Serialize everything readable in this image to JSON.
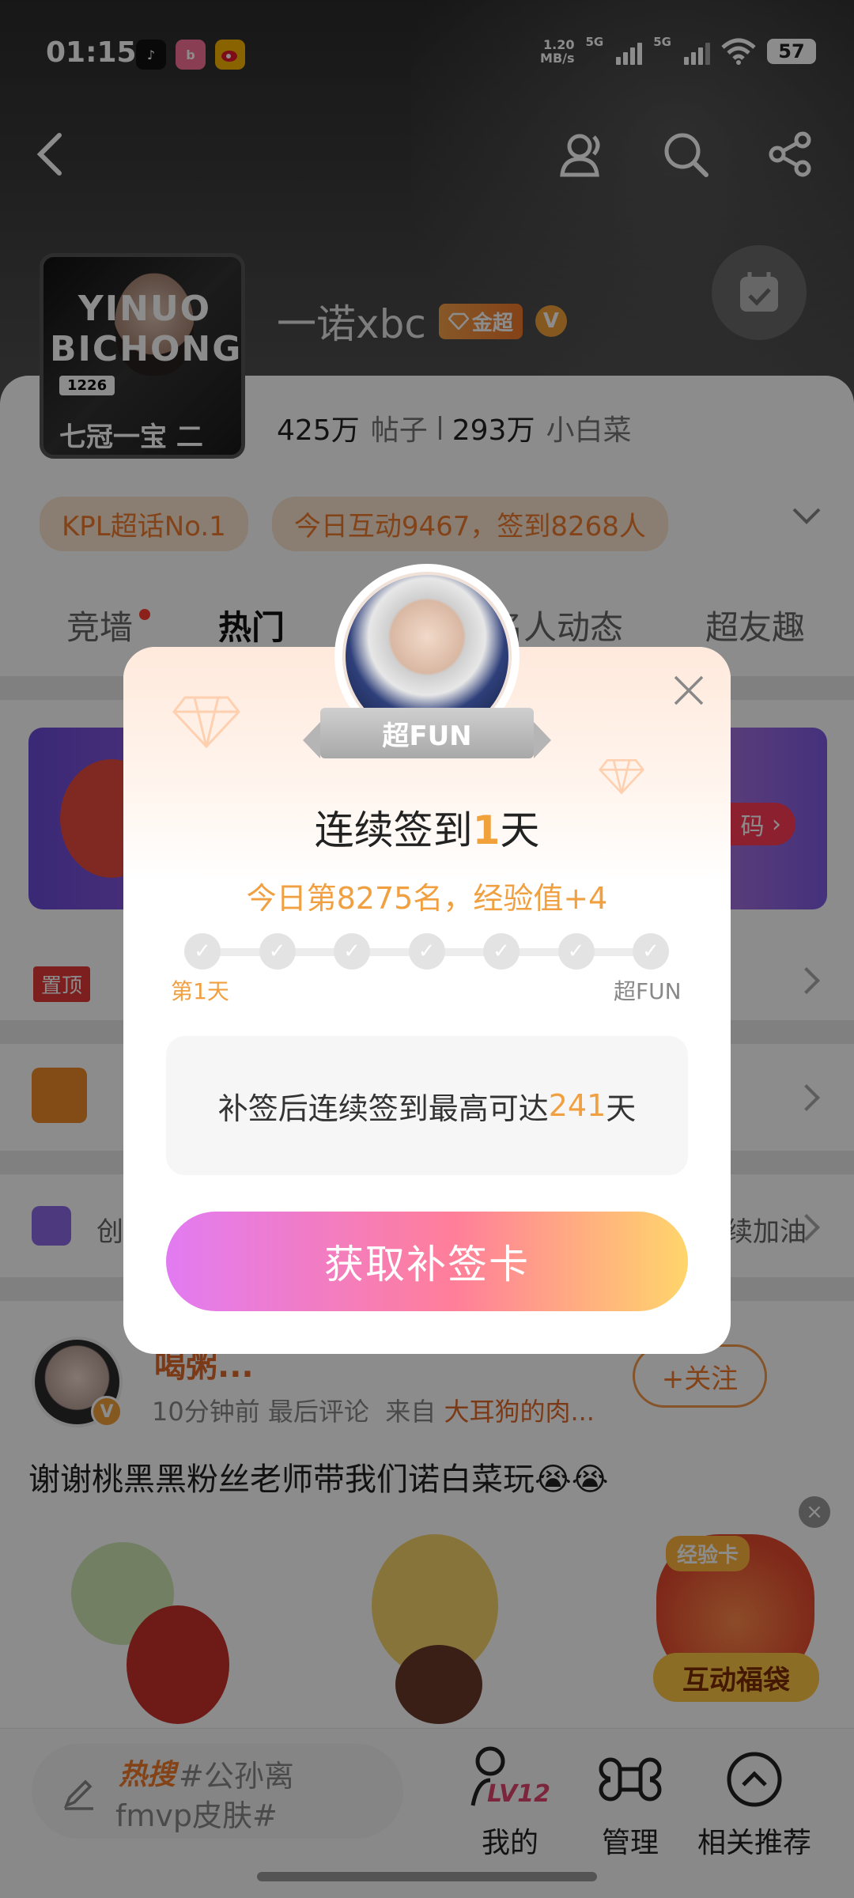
{
  "status_bar": {
    "time": "01:15",
    "net_speed_value": "1.20",
    "net_speed_unit": "MB/s",
    "sig1_label": "5G",
    "sig2_label": "5G",
    "battery": "57",
    "app_icons": [
      "tiktok-icon",
      "bilibili-icon",
      "weibo-icon"
    ]
  },
  "nav": {
    "icons": [
      "back-icon",
      "people-icon",
      "search-icon",
      "share-icon"
    ]
  },
  "profile": {
    "name": "一诺xbc",
    "badge_label": "金超",
    "v_badge": "V",
    "poster_title": "YINUO BICHONG",
    "poster_number": "1226",
    "poster_mvp": "七冠一宝 二FMVP"
  },
  "stats": {
    "posts_value": "425万",
    "posts_unit": "帖子",
    "fans_value": "293万",
    "fans_unit": "小白菜"
  },
  "tags": [
    "KPL超话No.1",
    "今日互动9467，签到8268人"
  ],
  "tabs": [
    "竞墙",
    "热门",
    "名人动态",
    "超友趣"
  ],
  "banner": {
    "pill_text": "码"
  },
  "pinned": {
    "tag": "置顶"
  },
  "create": {
    "prefix": "创",
    "suffix": "续加油"
  },
  "post": {
    "name": "喝粥...",
    "time": "10分钟前",
    "last_comment": "最后评论",
    "from_label": "来自",
    "source": "大耳狗的肉...",
    "follow": "+关注",
    "body": "谢谢桃黑黑粉丝老师带我们诺白菜玩😭😭"
  },
  "floating": {
    "tag": "经验卡",
    "label": "互动福袋"
  },
  "bottom_bar": {
    "hot_label": "热搜",
    "hot_line1": "#公孙离",
    "hot_line2": "fmvp皮肤#",
    "level": "LV12",
    "items": [
      "我的",
      "管理",
      "相关推荐"
    ]
  },
  "modal": {
    "ribbon": "超FUN",
    "title_prefix": "连续签到",
    "title_days": "1",
    "title_suffix": "天",
    "subtitle": "今日第8275名，经验值+4",
    "progress_start_label": "第1天",
    "progress_end_label": "超FUN",
    "progress_days_total": 7,
    "progress_days_done": 1,
    "info_prefix": "补签后连续签到最高可达",
    "info_days": "241",
    "info_suffix": "天",
    "cta": "获取补签卡"
  },
  "colors": {
    "accent_orange": "#f0782b",
    "modal_highlight": "#f0a040",
    "cta_gradient": [
      "#e27bf2",
      "#ff7e9a",
      "#ffd56b"
    ]
  }
}
